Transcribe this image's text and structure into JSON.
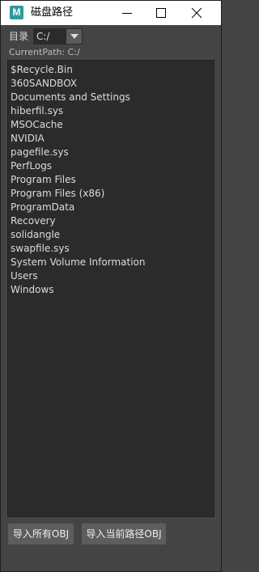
{
  "window": {
    "title": "磁盘路径",
    "app_icon_letter": "M"
  },
  "directory": {
    "label": "目录",
    "selected": "C:/"
  },
  "current_path": "CurrentPath: C:/",
  "files": [
    "$Recycle.Bin",
    "360SANDBOX",
    "Documents and Settings",
    "hiberfil.sys",
    "MSOCache",
    "NVIDIA",
    "pagefile.sys",
    "PerfLogs",
    "Program Files",
    "Program Files (x86)",
    "ProgramData",
    "Recovery",
    "solidangle",
    "swapfile.sys",
    "System Volume Information",
    "Users",
    "Windows"
  ],
  "buttons": {
    "import_all": "导入所有OBJ",
    "import_current": "导入当前路径OBJ"
  },
  "colors": {
    "window_bg": "#444444",
    "list_bg": "#2b2b2b",
    "button_bg": "#5d5d5d",
    "app_icon": "#2e9c9c"
  }
}
